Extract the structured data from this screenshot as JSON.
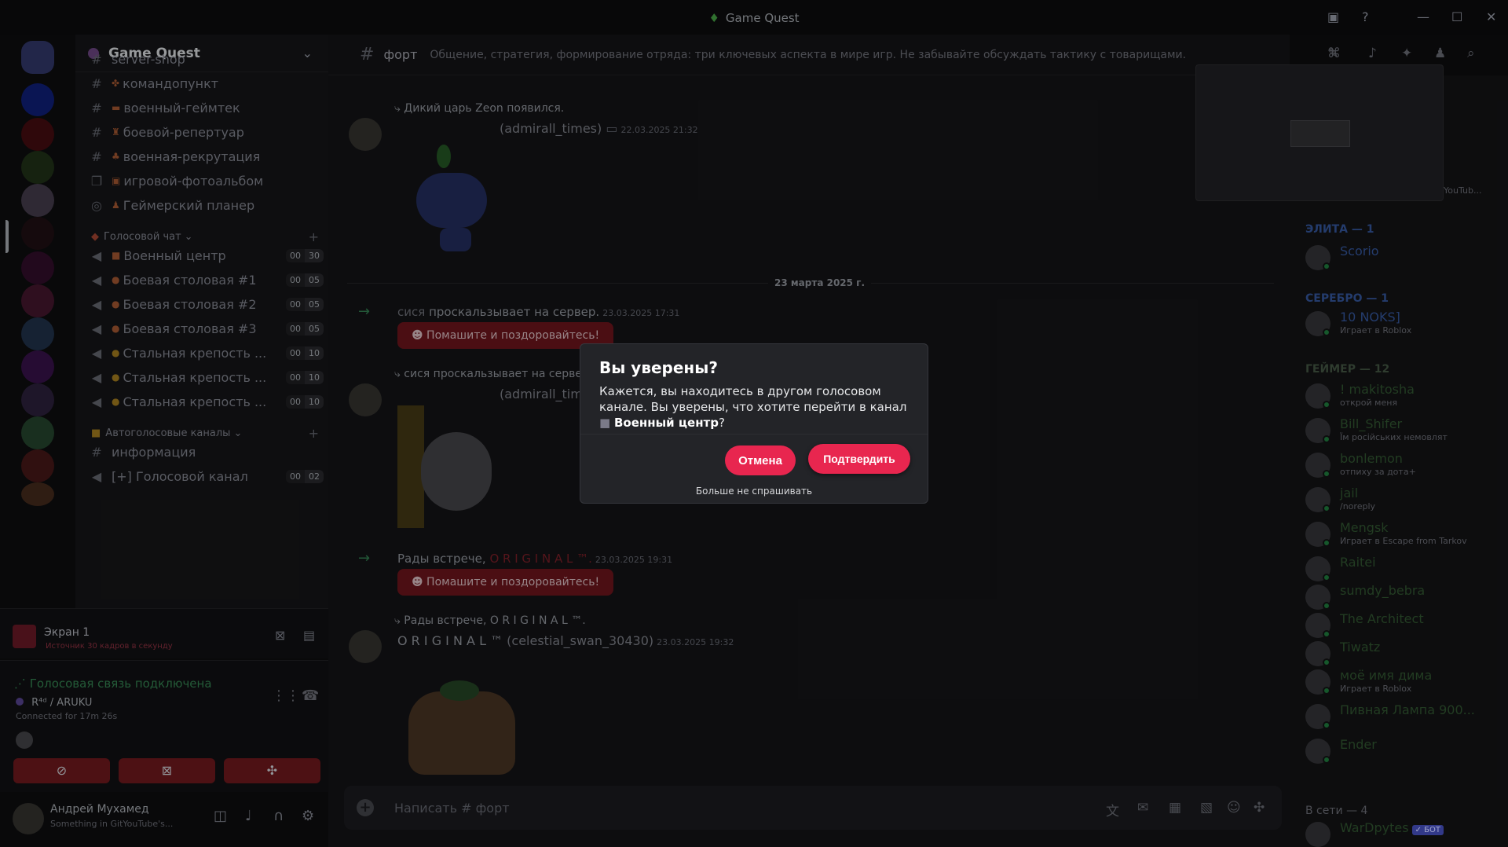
{
  "window": {
    "title": "Game Quest"
  },
  "server": {
    "name": "Game Quest",
    "text_channels": [
      {
        "name": "команд​опункт"
      },
      {
        "name": "военный-геймтек"
      },
      {
        "name": "боевой-репертуар"
      },
      {
        "name": "военная-рекрутация"
      },
      {
        "name": "игровой-фотоальбом"
      },
      {
        "name": "Геймерский планер"
      }
    ],
    "top_channel_partial": "server-shop",
    "voice_category": "Голосовой чат",
    "voice_channels": [
      {
        "name": "Военный центр",
        "count": "00",
        "limit": "30"
      },
      {
        "name": "Боевая столовая #1",
        "count": "00",
        "limit": "05"
      },
      {
        "name": "Боевая столовая #2",
        "count": "00",
        "limit": "05"
      },
      {
        "name": "Боевая столовая #3",
        "count": "00",
        "limit": "05"
      },
      {
        "name": "Стальная крепость ...",
        "count": "00",
        "limit": "10"
      },
      {
        "name": "Стальная крепость ...",
        "count": "00",
        "limit": "10"
      },
      {
        "name": "Стальная крепость ...",
        "count": "00",
        "limit": "10"
      }
    ],
    "auto_category": "Автоголосовые каналы",
    "auto_channels": [
      {
        "name": "информация"
      },
      {
        "name": "[+] Голосовой канал",
        "count": "00",
        "limit": "02"
      }
    ]
  },
  "screen_share": {
    "title": "Экран 1",
    "subtitle": "Источник 30 кадров в секунду"
  },
  "voice": {
    "status": "Голосовая связь подключена",
    "channel": "R⁴ᵈ / ARUKU",
    "connected_for": "Connected for 17m 26s"
  },
  "user": {
    "name": "Андрей Мухамед",
    "status": "Something in GitYouTube's..."
  },
  "chat": {
    "channel_name": "форт",
    "topic": "Общение, стратегия, формирование отряда: три ключевых аспекта в мире игр. Не забывайте обсуждать тактику с товарищами.",
    "messages": {
      "m1_reply": "Дикий царь Zeon появился.",
      "m1_author": "(admirall_times)",
      "m1_time": "22.03.2025 21:32",
      "date_divider": "23 марта 2025 г.",
      "m2_user": "сися",
      "m2_text": "проскальзывает на сервер.",
      "m2_time": "23.03.2025 17:31",
      "wave_label": "Помашите и поздоровайтесь!",
      "m3_reply": "сися проскальзывает на сервер.",
      "m3_author": "(admirall_time",
      "m4_text": "Рады встрече,",
      "m4_user": "O R I G I N A L ™.",
      "m4_time": "23.03.2025 19:31",
      "m5_reply": "Рады встрече, O R I G I N A L ™.",
      "m5_author": "O R I G I N A L ™",
      "m5_handle": "(celestial_swan_30430)",
      "m5_time": "23.03.2025 19:32"
    },
    "composer_placeholder": "Написать # форт"
  },
  "members": {
    "groups": [
      {
        "label": "ЭЛИТА — 1"
      },
      {
        "label": "СЕРЕБРО — 1"
      },
      {
        "label": "ГЕЙМЕР — 12"
      },
      {
        "label": "В сети — 4"
      }
    ],
    "list": [
      {
        "name": "Scorio",
        "sub": "",
        "color": "#3a6bc9"
      },
      {
        "name": "10 NOKS]",
        "sub": "Играет в Roblox",
        "color": "#3a6bc9"
      },
      {
        "name": "! makitosha",
        "sub": "открой меня",
        "color": "#2f7a3e"
      },
      {
        "name": "Bill_Shifer",
        "sub": "Їм російських немовлят",
        "color": "#2f7a3e"
      },
      {
        "name": "bonlemon",
        "sub": "отпиху за дота+",
        "color": "#2f7a3e"
      },
      {
        "name": "jail",
        "sub": "/noreply",
        "color": "#2f7a3e"
      },
      {
        "name": "Mengsk",
        "sub": "Играет в Escape from Tarkov",
        "color": "#2f7a3e"
      },
      {
        "name": "Raitei",
        "sub": "",
        "color": "#2f7a3e"
      },
      {
        "name": "sumdy_bebra",
        "sub": "",
        "color": "#2f7a3e"
      },
      {
        "name": "The Architect",
        "sub": "",
        "color": "#2f7a3e"
      },
      {
        "name": "Tiwatz",
        "sub": "",
        "color": "#2f7a3e"
      },
      {
        "name": "моё имя дима",
        "sub": "Играет в Roblox",
        "color": "#2f7a3e"
      },
      {
        "name": "Пивная Лампа 900...",
        "sub": "",
        "color": "#2f7a3e"
      },
      {
        "name": "Ender",
        "sub": "",
        "color": "#2f7a3e"
      },
      {
        "name": "WarDpytes",
        "sub": "",
        "color": "#2f7a3e",
        "badge": "✓ БОТ"
      }
    ],
    "pip_label": "YouTub..."
  },
  "modal": {
    "title": "Вы уверены?",
    "body_text": "Кажется, вы находитесь в другом голосовом канале. Вы уверены, что хотите перейти в канал",
    "channel": "Военный центр",
    "question_mark": "?",
    "cancel_label": "Отмена",
    "confirm_label": "Подтвердить",
    "dont_ask": "Больше не спрашивать"
  },
  "colors": {
    "accent": "#e8264f",
    "danger_btn": "#5e1519",
    "online": "#1b6b35"
  }
}
